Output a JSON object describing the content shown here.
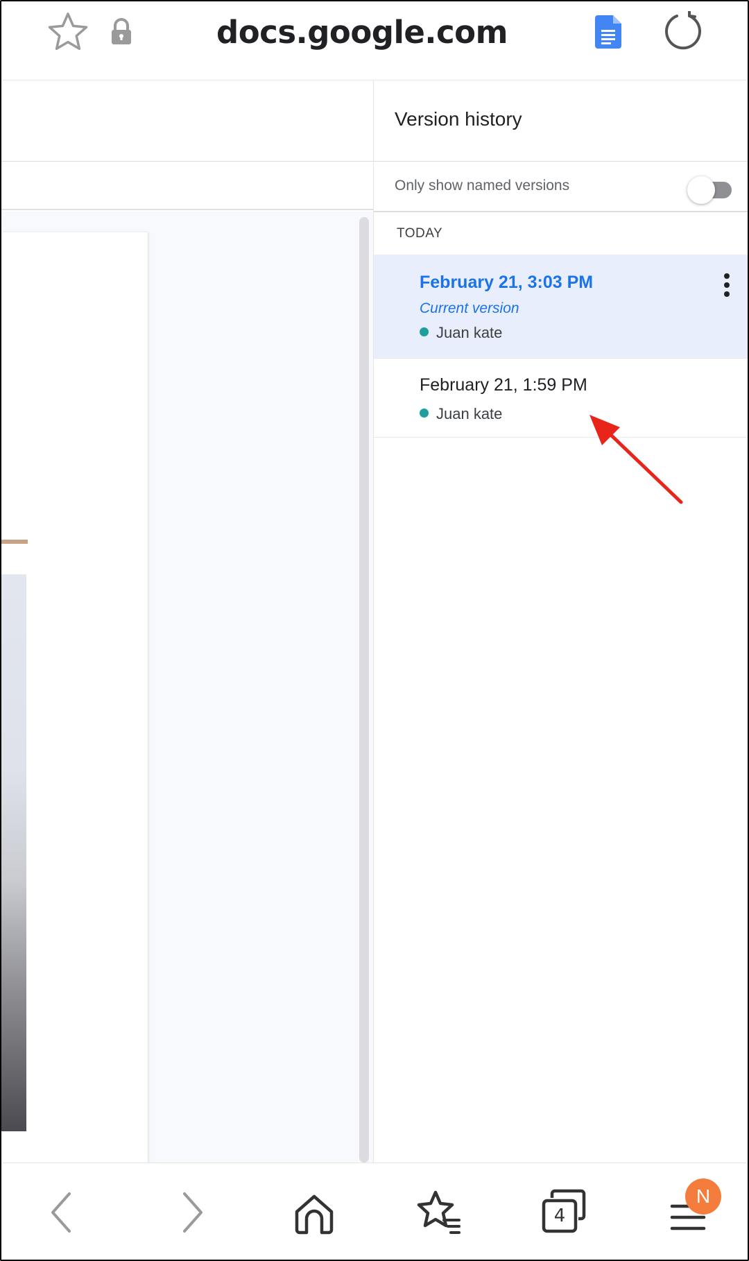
{
  "browser": {
    "domain": "docs.google.com",
    "icons": [
      "star-icon",
      "lock-icon",
      "google-docs-icon",
      "reload-icon"
    ]
  },
  "version_history": {
    "title": "Version history",
    "filter_label": "Only show named versions",
    "filter_enabled": false,
    "section_label": "TODAY",
    "versions": [
      {
        "timestamp": "February 21, 3:03 PM",
        "label": "Current version",
        "author": "Juan kate",
        "selected": true
      },
      {
        "timestamp": "February 21, 1:59 PM",
        "author": "Juan kate",
        "selected": false
      }
    ]
  },
  "bottom_nav": {
    "tabs_count": "4",
    "profile_initial": "N",
    "icons": [
      "back-icon",
      "forward-icon",
      "home-icon",
      "bookmarks-icon",
      "tabs-icon",
      "menu-icon"
    ]
  },
  "colors": {
    "accent": "#1a73e8",
    "selected_bg": "#e8eefb",
    "author_dot": "#1e9e9e",
    "annotation_arrow": "#e8251b",
    "profile_badge": "#f47c3c"
  }
}
